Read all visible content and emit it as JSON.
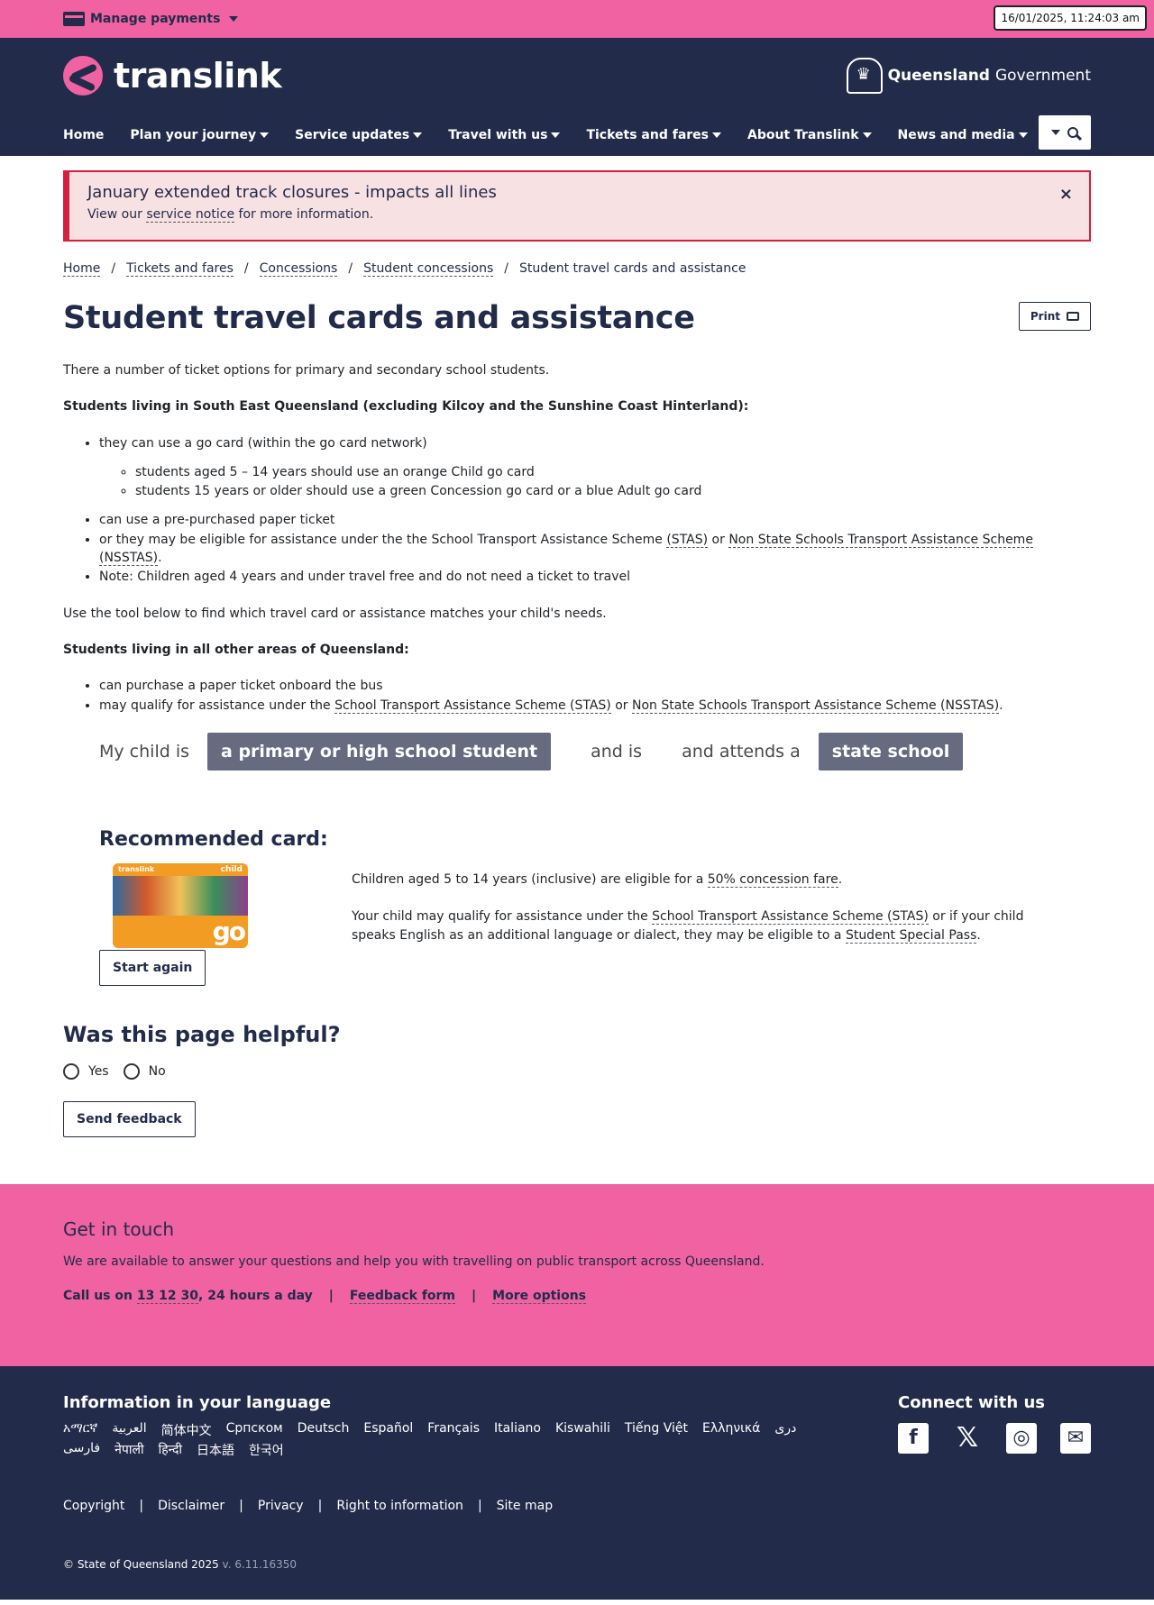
{
  "utility": {
    "manage_payments": "Manage payments",
    "clock": "16/01/2025, 11:24:03 am"
  },
  "brand": {
    "name": "translink",
    "gov_bold": "Queensland",
    "gov_rest": "Government"
  },
  "nav": [
    "Home",
    "Plan your journey",
    "Service updates",
    "Travel with us",
    "Tickets and fares",
    "About Translink",
    "News and media"
  ],
  "alert": {
    "title": "January extended track closures - impacts all lines",
    "prefix": "View our ",
    "link": "service notice",
    "suffix": " for more information.",
    "close": "×"
  },
  "breadcrumb": [
    "Home",
    "Tickets and fares",
    "Concessions",
    "Student concessions",
    "Student travel cards and assistance"
  ],
  "page": {
    "title": "Student travel cards and assistance",
    "print": "Print"
  },
  "content": {
    "intro": "There a number of ticket options for primary and secondary school students.",
    "seq_heading": "Students living in South East Queensland (excluding Kilcoy and the Sunshine Coast Hinterland):",
    "seq_item1": "they can use a go card (within the go card network)",
    "seq_sub1": "students aged 5 – 14 years should use an orange Child go card",
    "seq_sub2": "students 15 years or older should use a green Concession go card or a blue Adult go card",
    "seq_item2": "can use a pre-purchased paper ticket",
    "seq_item3_prefix": "or they may be eligible for assistance under the the School Transport Assistance Scheme ",
    "seq_item3_link1": "(STAS)",
    "seq_item3_mid": " or ",
    "seq_item3_link2": "Non State Schools Transport Assistance Scheme (NSSTAS)",
    "seq_item3_end": ".",
    "seq_item4": "Note: Children aged 4 years and under travel free and do not need a ticket to travel",
    "tool_intro": "Use the tool below to find which travel card or assistance matches your child's needs.",
    "other_heading": "Students living in all other areas of Queensland:",
    "other_item1": "can purchase a paper ticket onboard the bus",
    "other_item2_prefix": "may qualify for assistance under the ",
    "other_item2_link1": "School Transport Assistance Scheme (STAS)",
    "other_item2_mid": " or ",
    "other_item2_link2": "Non State Schools Transport Assistance Scheme (NSSTAS)",
    "other_item2_end": "."
  },
  "tool": {
    "t1": "My child is",
    "s1": "a primary or high school student",
    "t2": "and is",
    "t3": "and attends a",
    "s2": "state school"
  },
  "recommended": {
    "heading": "Recommended card:",
    "card_brand": "translink",
    "card_kind": "child",
    "card_go": "go",
    "start_again": "Start again",
    "p1_prefix": "Children aged 5 to 14 years (inclusive) are eligible for a ",
    "p1_link": "50% concession fare",
    "p1_end": ".",
    "p2_prefix": "Your child may qualify for assistance under the ",
    "p2_link1": "School Transport Assistance Scheme (STAS)",
    "p2_mid": " or if your child speaks English as an additional language or dialect, they may be eligible to a ",
    "p2_link2": "Student Special Pass",
    "p2_end": "."
  },
  "helpful": {
    "heading": "Was this page helpful?",
    "yes": "Yes",
    "no": "No",
    "send": "Send feedback"
  },
  "contact": {
    "heading": "Get in touch",
    "desc": "We are available to answer your questions and help you with travelling on public transport across Queensland.",
    "call_prefix": "Call us on ",
    "phone": "13 12 30",
    "call_suffix": ", 24 hours a day",
    "feedback": "Feedback form",
    "more": "More options",
    "sep": "|"
  },
  "footer": {
    "lang_heading": "Information in your language",
    "languages": [
      "አማርኛ",
      "العربية",
      "简体中文",
      "Српском",
      "Deutsch",
      "Español",
      "Français",
      "Italiano",
      "Kiswahili",
      "Tiếng Việt",
      "Ελληνικά",
      "دری",
      "فارسی",
      "नेपाली",
      "हिन्दी",
      "日本語",
      "한국어"
    ],
    "connect_heading": "Connect with us",
    "links": [
      "Copyright",
      "Disclaimer",
      "Privacy",
      "Right to information",
      "Site map"
    ],
    "sep": "|",
    "copyright": "© State of Queensland 2025",
    "version": "v. 6.11.16350"
  },
  "colors": {
    "pink": "#f062a1",
    "navy": "#222b4a",
    "alert_red": "#d71e3a",
    "pill": "#666b80"
  }
}
